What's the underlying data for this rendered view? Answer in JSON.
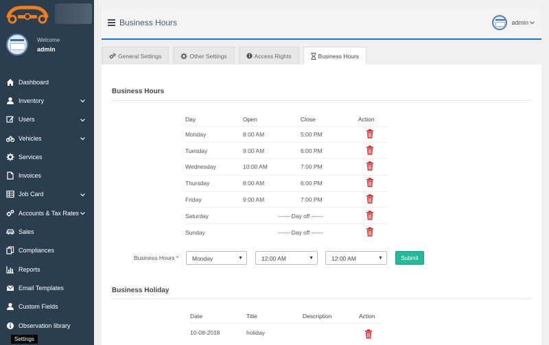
{
  "sidebar": {
    "welcome": "Welcome",
    "username": "admin",
    "items": [
      {
        "label": "Dashboard",
        "icon": "home-icon",
        "chevron": false
      },
      {
        "label": "Inventory",
        "icon": "user-icon",
        "chevron": true
      },
      {
        "label": "Users",
        "icon": "edit-icon",
        "chevron": true
      },
      {
        "label": "Vehicles",
        "icon": "motorcycle-icon",
        "chevron": true
      },
      {
        "label": "Services",
        "icon": "cog-icon",
        "chevron": false
      },
      {
        "label": "Invoices",
        "icon": "file-icon",
        "chevron": false
      },
      {
        "label": "Job Card",
        "icon": "table-icon",
        "chevron": true
      },
      {
        "label": "Accounts & Tax Rates",
        "icon": "cogs-icon",
        "chevron": true
      },
      {
        "label": "Sales",
        "icon": "car-icon",
        "chevron": false
      },
      {
        "label": "Compliances",
        "icon": "copy-icon",
        "chevron": false
      },
      {
        "label": "Reports",
        "icon": "bar-chart-icon",
        "chevron": false
      },
      {
        "label": "Email Templates",
        "icon": "envelope-icon",
        "chevron": false
      },
      {
        "label": "Custom Fields",
        "icon": "user-icon",
        "chevron": false
      },
      {
        "label": "Observation library",
        "icon": "info-circle-icon",
        "chevron": false
      }
    ],
    "tooltip": "Settings"
  },
  "header": {
    "title": "Business Hours",
    "user": "admin"
  },
  "tabs": [
    {
      "label": "General Settings",
      "icon": "cogs-icon",
      "active": false
    },
    {
      "label": "Other Settings",
      "icon": "cog-icon",
      "active": false
    },
    {
      "label": "Access Rights",
      "icon": "info-circle-icon",
      "active": false
    },
    {
      "label": "Business Hours",
      "icon": "hourglass-icon",
      "active": true
    }
  ],
  "business_hours": {
    "title": "Business Hours",
    "columns": [
      "Day",
      "Open",
      "Close",
      "Action"
    ],
    "rows": [
      {
        "day": "Monday",
        "open": "8:00 AM",
        "close": "5:00 PM",
        "off": ""
      },
      {
        "day": "Tuesday",
        "open": "9:00 AM",
        "close": "6:00 PM",
        "off": ""
      },
      {
        "day": "Wednesday",
        "open": "10:00 AM",
        "close": "7:00 PM",
        "off": ""
      },
      {
        "day": "Thursday",
        "open": "8:00 AM",
        "close": "6:00 PM",
        "off": ""
      },
      {
        "day": "Friday",
        "open": "9:00 AM",
        "close": "7:00 PM",
        "off": ""
      },
      {
        "day": "Saturday",
        "open": "",
        "close": "",
        "off": "------ Day off ------"
      },
      {
        "day": "Sunday",
        "open": "",
        "close": "",
        "off": "------ Day off ------"
      }
    ]
  },
  "form": {
    "label": "Business Hours",
    "required_mark": "*",
    "day_value": "Monday",
    "open_value": "12:00 AM",
    "close_value": "12:00 AM",
    "submit_label": "Submit"
  },
  "business_holiday": {
    "title": "Business Holiday",
    "columns": [
      "Date",
      "Title",
      "Description",
      "Action"
    ],
    "rows": [
      {
        "date": "10-08-2018",
        "title": "holiday",
        "description": ""
      }
    ]
  },
  "colors": {
    "sidebar_bg": "#2b3e50",
    "accent": "#2f6ead",
    "submit": "#26b99a",
    "delete": "#e02020",
    "logo": "#f07c1e"
  }
}
